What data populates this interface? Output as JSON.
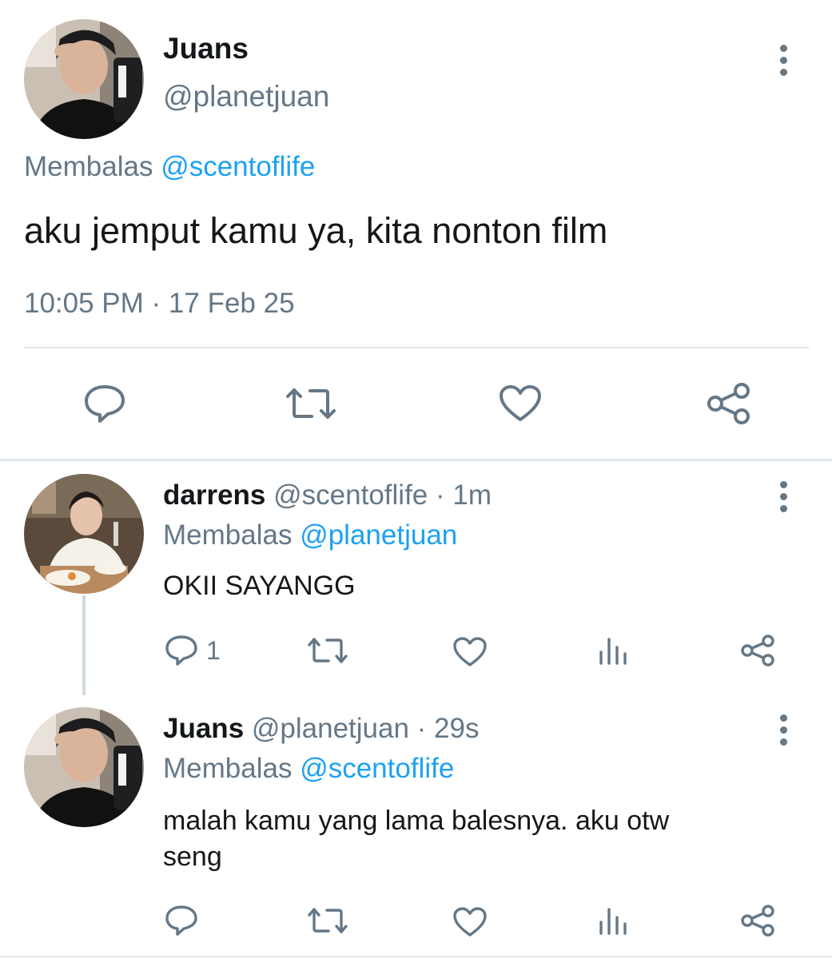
{
  "main_tweet": {
    "author_name": "Juans",
    "handle": "@planetjuan",
    "replying_prefix": "Membalas",
    "replying_to": "@scentoflife",
    "text": "aku jemput kamu ya, kita nonton film",
    "timestamp": "10:05 PM · 17 Feb 25",
    "actions": [
      "reply-icon",
      "retweet-icon",
      "like-icon",
      "share-icon"
    ]
  },
  "replies": [
    {
      "author_name": "darrens",
      "handle_time": "@scentoflife · 1m",
      "replying_prefix": "Membalas",
      "replying_to": "@planetjuan",
      "text": "OKII SAYANGG",
      "reply_count": "1",
      "actions": [
        "reply-icon",
        "retweet-icon",
        "like-icon",
        "analytics-icon",
        "share-icon"
      ]
    },
    {
      "author_name": "Juans",
      "handle_time": "@planetjuan · 29s",
      "replying_prefix": "Membalas",
      "replying_to": "@scentoflife",
      "text_line1": "malah kamu yang lama balesnya. aku otw",
      "text_line2": "seng",
      "reply_count": "",
      "actions": [
        "reply-icon",
        "retweet-icon",
        "like-icon",
        "analytics-icon",
        "share-icon"
      ]
    }
  ],
  "colors": {
    "accent": "#1da1f2",
    "muted": "#657786",
    "text": "#14171a",
    "divider": "#e1e8ed"
  }
}
